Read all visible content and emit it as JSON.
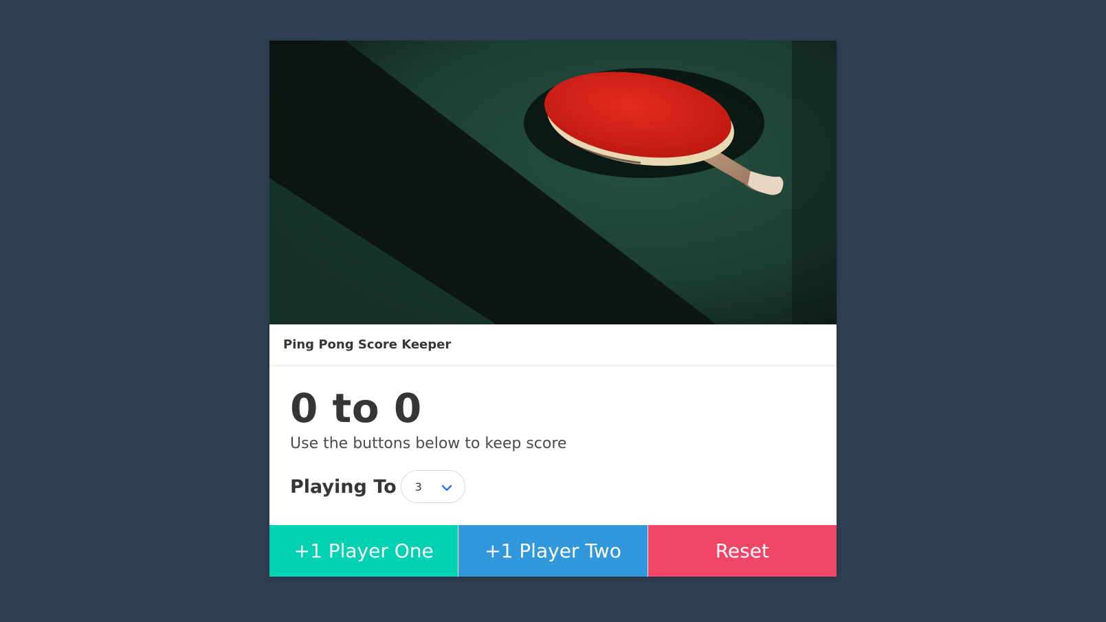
{
  "header": {
    "title": "Ping Pong Score Keeper"
  },
  "score": {
    "text": "0 to 0",
    "subtitle": "Use the buttons below to keep score"
  },
  "playing_to": {
    "label": "Playing To",
    "value": "3"
  },
  "buttons": {
    "player_one": "+1 Player One",
    "player_two": "+1 Player Two",
    "reset": "Reset"
  },
  "colors": {
    "background": "#2f3f52",
    "player_one": "#00d1b2",
    "player_two": "#3298dc",
    "reset": "#f14668"
  }
}
